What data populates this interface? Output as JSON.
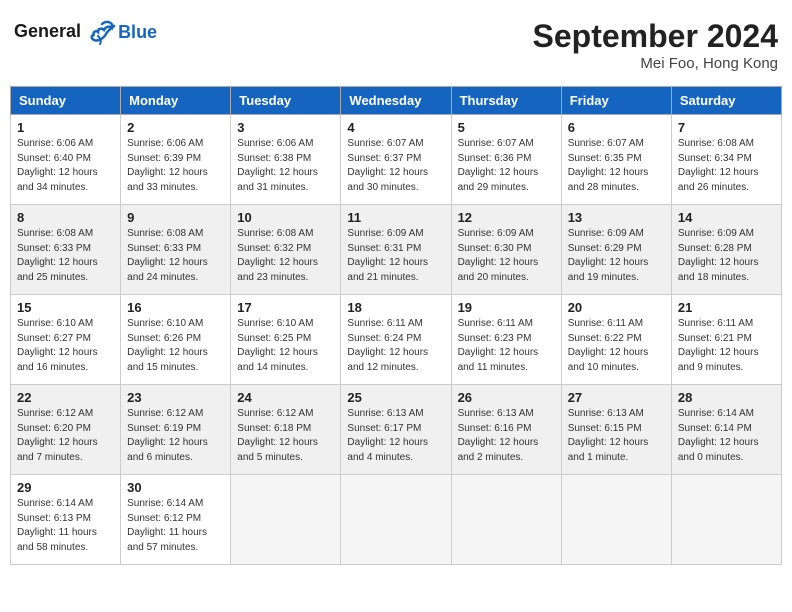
{
  "header": {
    "logo_line1": "General",
    "logo_line2": "Blue",
    "month_title": "September 2024",
    "location": "Mei Foo, Hong Kong"
  },
  "days_of_week": [
    "Sunday",
    "Monday",
    "Tuesday",
    "Wednesday",
    "Thursday",
    "Friday",
    "Saturday"
  ],
  "weeks": [
    [
      {
        "num": "1",
        "sunrise": "6:06 AM",
        "sunset": "6:40 PM",
        "daylight": "12 hours and 34 minutes."
      },
      {
        "num": "2",
        "sunrise": "6:06 AM",
        "sunset": "6:39 PM",
        "daylight": "12 hours and 33 minutes."
      },
      {
        "num": "3",
        "sunrise": "6:06 AM",
        "sunset": "6:38 PM",
        "daylight": "12 hours and 31 minutes."
      },
      {
        "num": "4",
        "sunrise": "6:07 AM",
        "sunset": "6:37 PM",
        "daylight": "12 hours and 30 minutes."
      },
      {
        "num": "5",
        "sunrise": "6:07 AM",
        "sunset": "6:36 PM",
        "daylight": "12 hours and 29 minutes."
      },
      {
        "num": "6",
        "sunrise": "6:07 AM",
        "sunset": "6:35 PM",
        "daylight": "12 hours and 28 minutes."
      },
      {
        "num": "7",
        "sunrise": "6:08 AM",
        "sunset": "6:34 PM",
        "daylight": "12 hours and 26 minutes."
      }
    ],
    [
      {
        "num": "8",
        "sunrise": "6:08 AM",
        "sunset": "6:33 PM",
        "daylight": "12 hours and 25 minutes."
      },
      {
        "num": "9",
        "sunrise": "6:08 AM",
        "sunset": "6:33 PM",
        "daylight": "12 hours and 24 minutes."
      },
      {
        "num": "10",
        "sunrise": "6:08 AM",
        "sunset": "6:32 PM",
        "daylight": "12 hours and 23 minutes."
      },
      {
        "num": "11",
        "sunrise": "6:09 AM",
        "sunset": "6:31 PM",
        "daylight": "12 hours and 21 minutes."
      },
      {
        "num": "12",
        "sunrise": "6:09 AM",
        "sunset": "6:30 PM",
        "daylight": "12 hours and 20 minutes."
      },
      {
        "num": "13",
        "sunrise": "6:09 AM",
        "sunset": "6:29 PM",
        "daylight": "12 hours and 19 minutes."
      },
      {
        "num": "14",
        "sunrise": "6:09 AM",
        "sunset": "6:28 PM",
        "daylight": "12 hours and 18 minutes."
      }
    ],
    [
      {
        "num": "15",
        "sunrise": "6:10 AM",
        "sunset": "6:27 PM",
        "daylight": "12 hours and 16 minutes."
      },
      {
        "num": "16",
        "sunrise": "6:10 AM",
        "sunset": "6:26 PM",
        "daylight": "12 hours and 15 minutes."
      },
      {
        "num": "17",
        "sunrise": "6:10 AM",
        "sunset": "6:25 PM",
        "daylight": "12 hours and 14 minutes."
      },
      {
        "num": "18",
        "sunrise": "6:11 AM",
        "sunset": "6:24 PM",
        "daylight": "12 hours and 12 minutes."
      },
      {
        "num": "19",
        "sunrise": "6:11 AM",
        "sunset": "6:23 PM",
        "daylight": "12 hours and 11 minutes."
      },
      {
        "num": "20",
        "sunrise": "6:11 AM",
        "sunset": "6:22 PM",
        "daylight": "12 hours and 10 minutes."
      },
      {
        "num": "21",
        "sunrise": "6:11 AM",
        "sunset": "6:21 PM",
        "daylight": "12 hours and 9 minutes."
      }
    ],
    [
      {
        "num": "22",
        "sunrise": "6:12 AM",
        "sunset": "6:20 PM",
        "daylight": "12 hours and 7 minutes."
      },
      {
        "num": "23",
        "sunrise": "6:12 AM",
        "sunset": "6:19 PM",
        "daylight": "12 hours and 6 minutes."
      },
      {
        "num": "24",
        "sunrise": "6:12 AM",
        "sunset": "6:18 PM",
        "daylight": "12 hours and 5 minutes."
      },
      {
        "num": "25",
        "sunrise": "6:13 AM",
        "sunset": "6:17 PM",
        "daylight": "12 hours and 4 minutes."
      },
      {
        "num": "26",
        "sunrise": "6:13 AM",
        "sunset": "6:16 PM",
        "daylight": "12 hours and 2 minutes."
      },
      {
        "num": "27",
        "sunrise": "6:13 AM",
        "sunset": "6:15 PM",
        "daylight": "12 hours and 1 minute."
      },
      {
        "num": "28",
        "sunrise": "6:14 AM",
        "sunset": "6:14 PM",
        "daylight": "12 hours and 0 minutes."
      }
    ],
    [
      {
        "num": "29",
        "sunrise": "6:14 AM",
        "sunset": "6:13 PM",
        "daylight": "11 hours and 58 minutes."
      },
      {
        "num": "30",
        "sunrise": "6:14 AM",
        "sunset": "6:12 PM",
        "daylight": "11 hours and 57 minutes."
      },
      null,
      null,
      null,
      null,
      null
    ]
  ]
}
